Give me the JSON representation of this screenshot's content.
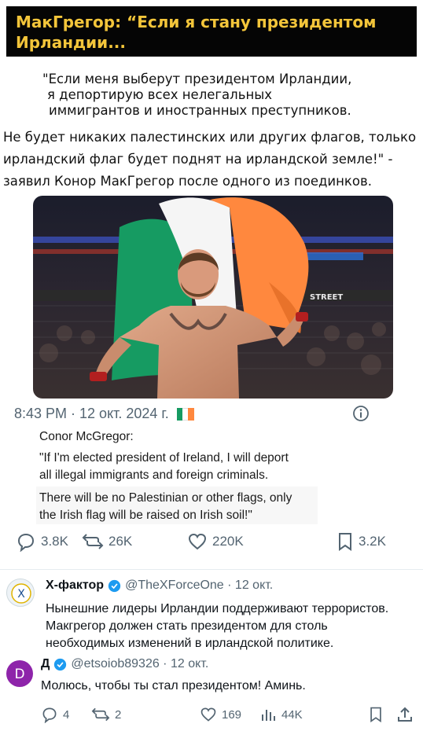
{
  "headline": {
    "line1": "МакГрегор: “Если я стану президентом",
    "line2": "Ирландии..."
  },
  "quote_ru": {
    "l1": "\"Если меня выберут президентом Ирландии,",
    "l2": "я депортирую  всех нелегальных",
    "l3": "иммигрантов и иностранных  преступников.",
    "l4": "Не будет никаких палестинских или других флагов, только",
    "l5": "ирландский флаг будет поднят на ирландской земле!\" -",
    "l6": "заявил Конор МакГрегор после одного из поединков."
  },
  "tweet": {
    "time": "8:43 PM · 12 окт. 2024 г.",
    "author_label": "Conor McGregor:",
    "quote_l1": "\"If I'm elected president of Ireland, I will deport",
    "quote_l2": "all illegal immigrants and foreign criminals.",
    "quote_l3": "There will be no Palestinian or other flags, only",
    "quote_l4": "the Irish flag will be raised on Irish soil!\"",
    "replies": "3.8K",
    "reposts": "26K",
    "likes": "220K",
    "bookmarks": "3.2K"
  },
  "photo_banner_text": "STREET",
  "replies": [
    {
      "name": "Х-фактор",
      "handle": "@TheXForceOne · 12 окт.",
      "avatar_letter": "X",
      "l1": "Нынешние лидеры Ирландии поддерживают террористов.",
      "l2": "Макгрегор должен стать президентом для столь",
      "l3": "необходимых  изменений   в ирландской политике."
    },
    {
      "name": "Д",
      "handle": "@etsoiob89326 · 12 окт.",
      "avatar_letter": "D",
      "l1": "Молюсь, чтобы ты стал президентом! Аминь."
    }
  ],
  "reply_actions": {
    "replies": "4",
    "reposts": "2",
    "likes": "169",
    "views": "44K"
  },
  "colors": {
    "headline_bg": "#050505",
    "headline_text": "#f3c53a",
    "flag_green": "#169b62",
    "flag_white": "#ffffff",
    "flag_orange": "#ff883e",
    "verified_blue": "#1d9bf0",
    "avatar_purple": "#8e24aa"
  }
}
